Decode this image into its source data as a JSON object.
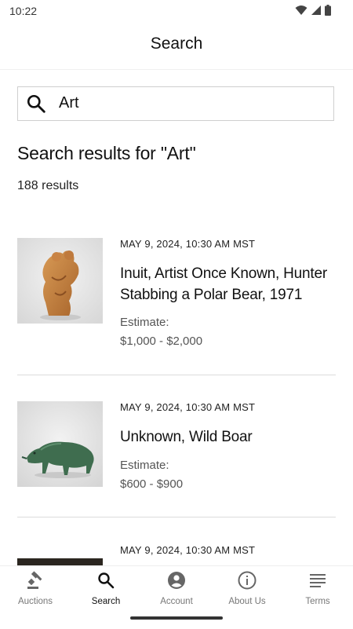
{
  "status_bar": {
    "time": "10:22",
    "icons": [
      "wifi-icon",
      "cell-signal-icon",
      "battery-icon"
    ]
  },
  "header": {
    "title": "Search"
  },
  "search": {
    "query": "Art",
    "icon": "search-icon"
  },
  "results": {
    "heading": "Search results for \"Art\"",
    "count": "188 results",
    "items": [
      {
        "date": "MAY 9, 2024, 10:30 AM MST",
        "title": "Inuit, Artist Once Known, Hunter Stabbing a Polar Bear, 1971",
        "estimate_label": "Estimate:",
        "estimate": "$1,000 - $2,000",
        "thumbnail": "carved-stone-sculpture-image"
      },
      {
        "date": "MAY 9, 2024, 10:30 AM MST",
        "title": "Unknown, Wild Boar",
        "estimate_label": "Estimate:",
        "estimate": "$600 - $900",
        "thumbnail": "bronze-boar-sculpture-image"
      },
      {
        "date": "MAY 9, 2024, 10:30 AM MST",
        "thumbnail": "dark-artwork-image"
      }
    ]
  },
  "bottom_nav": {
    "active": "Search",
    "items": [
      {
        "label": "Auctions",
        "icon": "gavel-icon"
      },
      {
        "label": "Search",
        "icon": "search-icon"
      },
      {
        "label": "Account",
        "icon": "account-circle-icon"
      },
      {
        "label": "About Us",
        "icon": "info-icon"
      },
      {
        "label": "Terms",
        "icon": "menu-lines-icon"
      }
    ]
  },
  "colors": {
    "text": "#111111",
    "muted": "#555555",
    "divider": "#dcdcdc",
    "nav_inactive": "#777777"
  }
}
